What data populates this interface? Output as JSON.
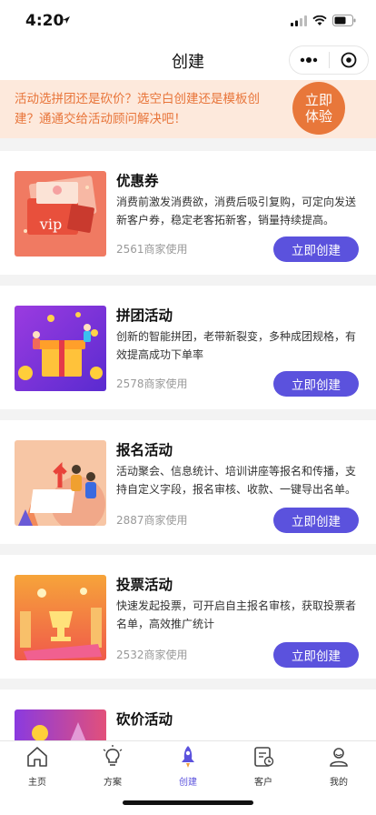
{
  "status": {
    "time": "4:20"
  },
  "nav": {
    "title": "创建"
  },
  "banner": {
    "text": "活动选拼团还是砍价？选空白创建还是模板创建？通通交给活动顾问解决吧！",
    "button": "立即体验"
  },
  "cards": [
    {
      "title": "优惠券",
      "desc": "消费前激发消费欲，消费后吸引复购，可定向发送新客户券，稳定老客拓新客，销量持续提高。",
      "usage": "2561商家使用",
      "button": "立即创建",
      "thumb_text": "vip"
    },
    {
      "title": "拼团活动",
      "desc": "创新的智能拼团，老带新裂变，多种成团规格，有效提高成功下单率",
      "usage": "2578商家使用",
      "button": "立即创建"
    },
    {
      "title": "报名活动",
      "desc": "活动聚会、信息统计、培训讲座等报名和传播，支持自定义字段，报名审核、收款、一键导出名单。",
      "usage": "2887商家使用",
      "button": "立即创建"
    },
    {
      "title": "投票活动",
      "desc": "快速发起投票，可开启自主报名审核，获取投票者名单，高效推广统计",
      "usage": "2532商家使用",
      "button": "立即创建"
    },
    {
      "title": "砍价活动",
      "desc": "",
      "usage": "",
      "button": ""
    }
  ],
  "tabs": [
    {
      "label": "主页",
      "icon": "home-icon"
    },
    {
      "label": "方案",
      "icon": "lightbulb-icon"
    },
    {
      "label": "创建",
      "icon": "rocket-icon"
    },
    {
      "label": "客户",
      "icon": "customer-icon"
    },
    {
      "label": "我的",
      "icon": "profile-icon"
    }
  ],
  "colors": {
    "accent": "#5b52dd",
    "banner_bg": "#fde9dc",
    "banner_text": "#e8753a",
    "banner_button": "#e8773a"
  }
}
